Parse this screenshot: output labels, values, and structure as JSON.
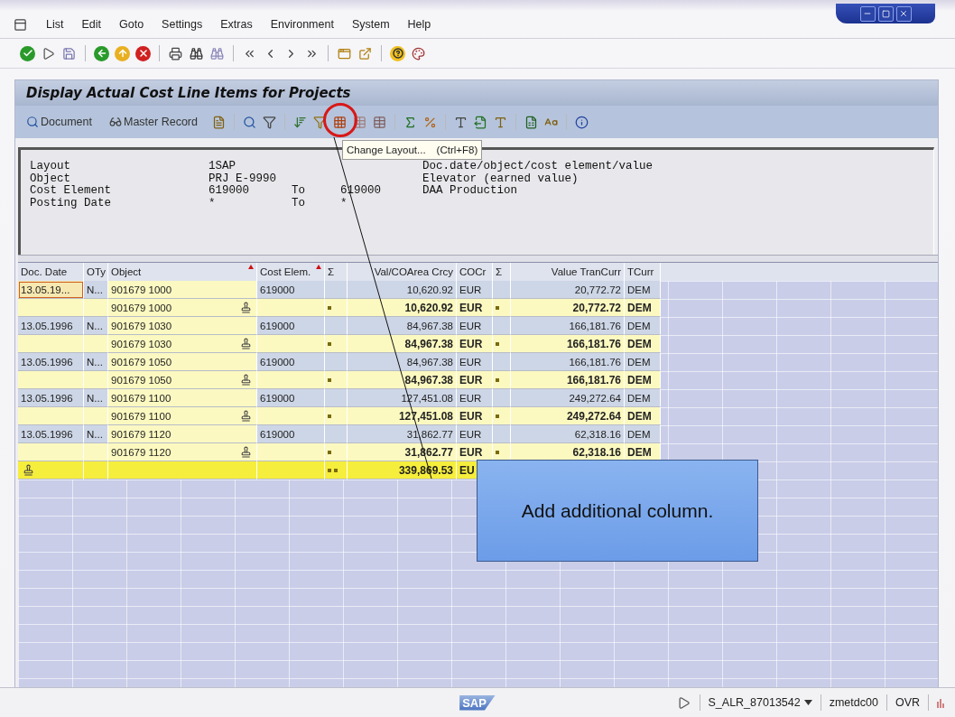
{
  "menu": {
    "items": [
      "List",
      "Edit",
      "Goto",
      "Settings",
      "Extras",
      "Environment",
      "System",
      "Help"
    ]
  },
  "title": "Display Actual Cost Line Items for Projects",
  "app_toolbar": {
    "buttons": [
      "Document",
      "Master Record"
    ],
    "layout_button_circled": true
  },
  "tooltip": {
    "text": "Change Layout...",
    "shortcut": "(Ctrl+F8)"
  },
  "header": {
    "lines": [
      {
        "label": "Layout",
        "value": "1SAP",
        "note": "Doc.date/object/cost element/value"
      },
      {
        "label": "Object",
        "value": "PRJ E-9990",
        "note": "Elevator (earned value)"
      },
      {
        "label": "Cost Element",
        "value": "619000",
        "to_label": "To",
        "to_value": "619000",
        "note": "DAA Production"
      },
      {
        "label": "Posting Date",
        "value": "*",
        "to_label": "To",
        "to_value": "*"
      }
    ]
  },
  "table": {
    "columns": [
      {
        "label": "Doc. Date",
        "kind": "text",
        "sorted": false
      },
      {
        "label": "OTy",
        "kind": "text",
        "sorted": false
      },
      {
        "label": "Object",
        "kind": "text",
        "sorted": true
      },
      {
        "label": "Cost Elem.",
        "kind": "text",
        "sorted": true
      },
      {
        "label": "Σ",
        "kind": "sigma",
        "sorted": false
      },
      {
        "label": "Val/COArea Crcy",
        "kind": "amount",
        "sorted": false
      },
      {
        "label": "COCr",
        "kind": "text",
        "sorted": false
      },
      {
        "label": "Σ",
        "kind": "sigma",
        "sorted": false
      },
      {
        "label": "Value TranCurr",
        "kind": "amount",
        "sorted": false
      },
      {
        "label": "TCurr",
        "kind": "text",
        "sorted": false
      }
    ],
    "rows": [
      {
        "kind": "item",
        "focused": true,
        "doc_date": "13.05.19...",
        "oty": "N...",
        "object": "901679 1000",
        "cost_element": "619000",
        "val_coarea": "10,620.92",
        "cocr": "EUR",
        "value_trancurr": "20,772.72",
        "tcurr": "DEM"
      },
      {
        "kind": "subtotal",
        "focused": false,
        "object": "901679 1000",
        "val_coarea": "10,620.92",
        "cocr": "EUR",
        "value_trancurr": "20,772.72",
        "tcurr": "DEM"
      },
      {
        "kind": "item",
        "focused": false,
        "doc_date": "13.05.1996",
        "oty": "N...",
        "object": "901679 1030",
        "cost_element": "619000",
        "val_coarea": "84,967.38",
        "cocr": "EUR",
        "value_trancurr": "166,181.76",
        "tcurr": "DEM"
      },
      {
        "kind": "subtotal",
        "focused": false,
        "object": "901679 1030",
        "val_coarea": "84,967.38",
        "cocr": "EUR",
        "value_trancurr": "166,181.76",
        "tcurr": "DEM"
      },
      {
        "kind": "item",
        "focused": false,
        "doc_date": "13.05.1996",
        "oty": "N...",
        "object": "901679 1050",
        "cost_element": "619000",
        "val_coarea": "84,967.38",
        "cocr": "EUR",
        "value_trancurr": "166,181.76",
        "tcurr": "DEM"
      },
      {
        "kind": "subtotal",
        "focused": false,
        "object": "901679 1050",
        "val_coarea": "84,967.38",
        "cocr": "EUR",
        "value_trancurr": "166,181.76",
        "tcurr": "DEM"
      },
      {
        "kind": "item",
        "focused": false,
        "doc_date": "13.05.1996",
        "oty": "N...",
        "object": "901679 1100",
        "cost_element": "619000",
        "val_coarea": "127,451.08",
        "cocr": "EUR",
        "value_trancurr": "249,272.64",
        "tcurr": "DEM"
      },
      {
        "kind": "subtotal",
        "focused": false,
        "object": "901679 1100",
        "val_coarea": "127,451.08",
        "cocr": "EUR",
        "value_trancurr": "249,272.64",
        "tcurr": "DEM"
      },
      {
        "kind": "item",
        "focused": false,
        "doc_date": "13.05.1996",
        "oty": "N...",
        "object": "901679 1120",
        "cost_element": "619000",
        "val_coarea": "31,862.77",
        "cocr": "EUR",
        "value_trancurr": "62,318.16",
        "tcurr": "DEM"
      },
      {
        "kind": "subtotal",
        "focused": false,
        "object": "901679 1120",
        "val_coarea": "31,862.77",
        "cocr": "EUR",
        "value_trancurr": "62,318.16",
        "tcurr": "DEM"
      },
      {
        "kind": "total",
        "focused": false,
        "val_coarea": "339,869.53",
        "cocr": "EU"
      }
    ]
  },
  "callout": {
    "text": "Add additional column."
  },
  "status_bar": {
    "logo": "SAP",
    "transaction": "S_ALR_87013542",
    "server": "zmetdc00",
    "mode": "OVR"
  }
}
